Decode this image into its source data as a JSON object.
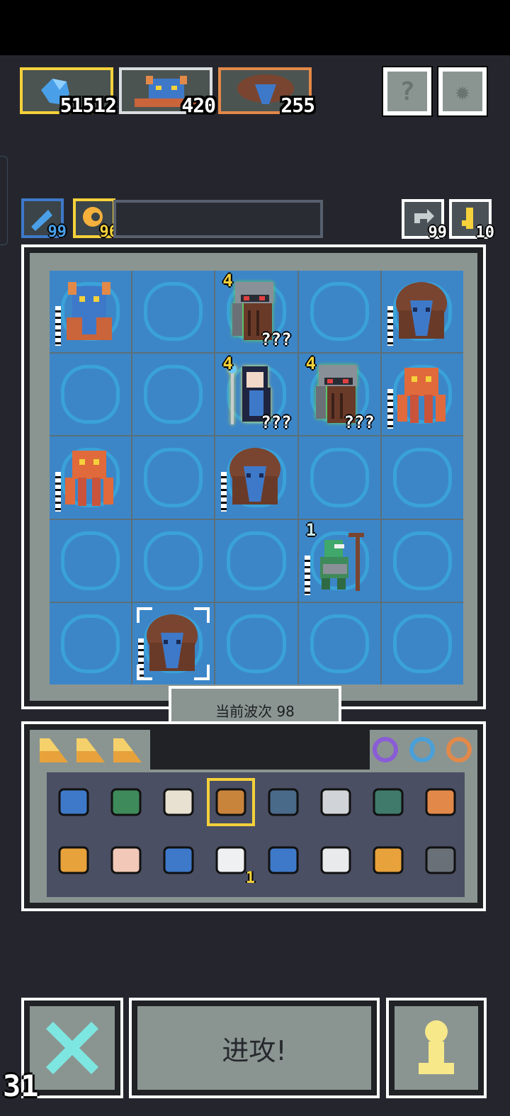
{
  "resources": [
    {
      "name": "crystal",
      "value": "51512",
      "border": "#f5d13b"
    },
    {
      "name": "demon",
      "value": "420",
      "border": "#d9dde0"
    },
    {
      "name": "treant",
      "value": "255",
      "border": "#e2894a"
    }
  ],
  "top_buttons": {
    "help_icon": "question-mark-icon",
    "settings_icon": "gear-icon"
  },
  "secondary": {
    "blue_value": "99",
    "gold_value": "96",
    "refresh_value": "99",
    "key_value": "10"
  },
  "board": {
    "grid_size": 5,
    "cells": [
      {
        "unit": "demon"
      },
      {
        "unit": ""
      },
      {
        "unit": "knight",
        "level": "4",
        "mystery": "???"
      },
      {
        "unit": ""
      },
      {
        "unit": "treant"
      },
      {
        "unit": ""
      },
      {
        "unit": ""
      },
      {
        "unit": "mage",
        "level": "4",
        "mystery": "???"
      },
      {
        "unit": "knight",
        "level": "4",
        "mystery": "???"
      },
      {
        "unit": "octopus"
      },
      {
        "unit": "octopus"
      },
      {
        "unit": ""
      },
      {
        "unit": "treant"
      },
      {
        "unit": ""
      },
      {
        "unit": ""
      },
      {
        "unit": ""
      },
      {
        "unit": ""
      },
      {
        "unit": ""
      },
      {
        "unit": "goblin",
        "level": "1"
      },
      {
        "unit": ""
      },
      {
        "unit": ""
      },
      {
        "unit": "treant",
        "selected": true
      },
      {
        "unit": ""
      },
      {
        "unit": ""
      },
      {
        "unit": ""
      }
    ]
  },
  "wave_label": "当前波次 98",
  "inventory": {
    "shards": 3,
    "rings": [
      "#8a5cd6",
      "#4aa0d8",
      "#e2894a"
    ],
    "items_row1": [
      "horned-mask",
      "green-shell",
      "torn-banner",
      "treasure-map",
      "stone-blocks",
      "sword",
      "green-gate",
      "staff"
    ],
    "items_row2": [
      "coil",
      "finger",
      "mirror-portrait",
      "cloud",
      "potion",
      "tombstone",
      "gear-ring",
      "hammer"
    ],
    "cloud_badge": "1"
  },
  "bottom": {
    "attack_label": "进攻!",
    "turn_counter": "31"
  }
}
